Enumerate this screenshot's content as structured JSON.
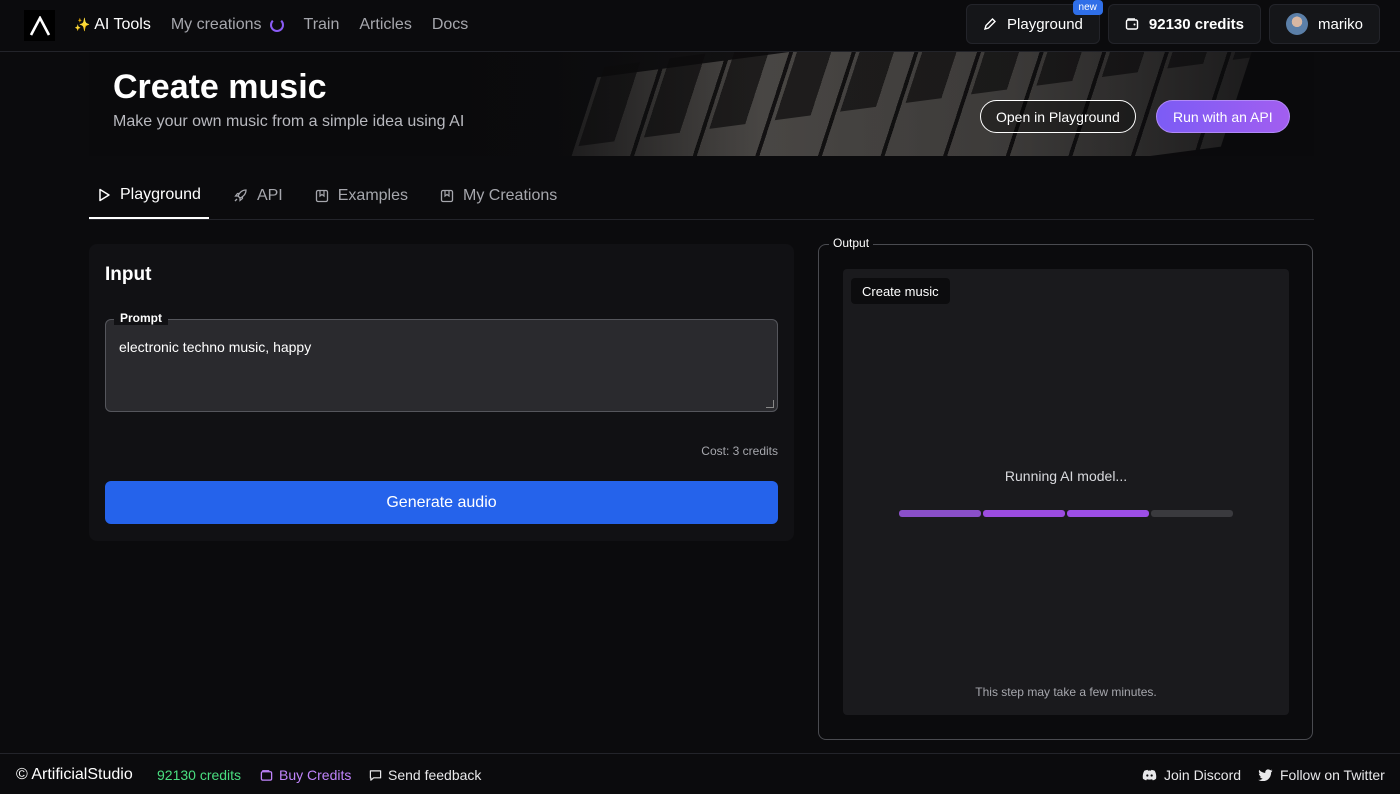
{
  "nav": {
    "ai_tools": "AI Tools",
    "my_creations": "My creations",
    "train": "Train",
    "articles": "Articles",
    "docs": "Docs",
    "playground": "Playground",
    "playground_badge": "new",
    "credits": "92130 credits",
    "username": "mariko"
  },
  "hero": {
    "title": "Create music",
    "subtitle": "Make your own music from a simple idea using AI",
    "open_playground": "Open in Playground",
    "run_api": "Run with an API"
  },
  "tabs": [
    {
      "label": "Playground",
      "icon": "play-icon",
      "active": true
    },
    {
      "label": "API",
      "icon": "rocket-icon",
      "active": false
    },
    {
      "label": "Examples",
      "icon": "bookmark-icon",
      "active": false
    },
    {
      "label": "My Creations",
      "icon": "bookmark-icon",
      "active": false
    }
  ],
  "input": {
    "title": "Input",
    "prompt_label": "Prompt",
    "prompt_value": "electronic techno music, happy",
    "cost": "Cost: 3 credits",
    "generate": "Generate audio"
  },
  "output": {
    "label": "Output",
    "chip": "Create music",
    "status": "Running AI model...",
    "progress_segments_total": 4,
    "progress_segments_done": 3,
    "hint": "This step may take a few minutes."
  },
  "footer": {
    "brand": "© ArtificialStudio",
    "credits": "92130 credits",
    "buy": "Buy Credits",
    "feedback": "Send feedback",
    "discord": "Join Discord",
    "twitter": "Follow on Twitter"
  },
  "colors": {
    "accent_blue": "#2563eb",
    "accent_purple": "#9b4ce0",
    "credits_green": "#4ade80",
    "buy_purple": "#c084fc"
  }
}
